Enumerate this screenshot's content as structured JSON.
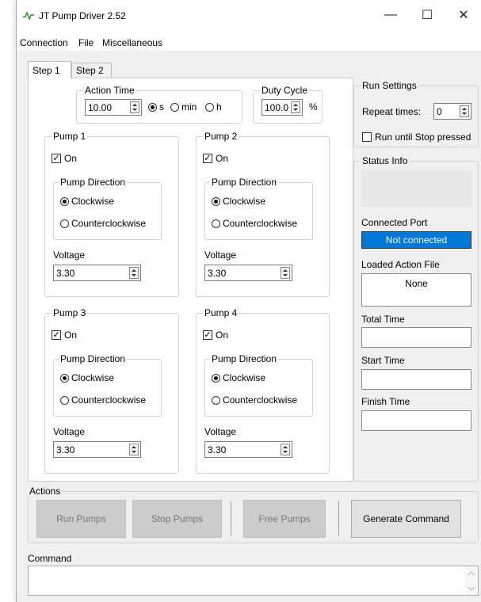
{
  "window": {
    "title": "JT Pump Driver 2.52",
    "minimize": "—",
    "maximize": "☐",
    "close": "✕",
    "accent": "#2a9d2a"
  },
  "menu": {
    "items": [
      "Connection",
      "File",
      "Miscellaneous"
    ]
  },
  "tabs": [
    "Step 1",
    "Step 2"
  ],
  "action_time": {
    "label": "Action Time",
    "value": "10.00",
    "units": [
      "s",
      "min",
      "h"
    ],
    "selected": "s"
  },
  "duty_cycle": {
    "label": "Duty Cycle",
    "value": "100.0",
    "unit": "%"
  },
  "pumps": [
    {
      "title": "Pump 1",
      "on_label": "On",
      "on": true,
      "direction_label": "Pump Direction",
      "cw": "Clockwise",
      "ccw": "Counterclockwise",
      "direction": "cw",
      "voltage_label": "Voltage",
      "voltage": "3.30"
    },
    {
      "title": "Pump 2",
      "on_label": "On",
      "on": true,
      "direction_label": "Pump Direction",
      "cw": "Clockwise",
      "ccw": "Counterclockwise",
      "direction": "cw",
      "voltage_label": "Voltage",
      "voltage": "3.30"
    },
    {
      "title": "Pump 3",
      "on_label": "On",
      "on": true,
      "direction_label": "Pump Direction",
      "cw": "Clockwise",
      "ccw": "Counterclockwise",
      "direction": "cw",
      "voltage_label": "Voltage",
      "voltage": "3.30"
    },
    {
      "title": "Pump 4",
      "on_label": "On",
      "on": true,
      "direction_label": "Pump Direction",
      "cw": "Clockwise",
      "ccw": "Counterclockwise",
      "direction": "cw",
      "voltage_label": "Voltage",
      "voltage": "3.30"
    }
  ],
  "run_settings": {
    "label": "Run Settings",
    "repeat_label": "Repeat times:",
    "repeat_value": "0",
    "run_until_label": "Run until Stop pressed",
    "run_until_checked": false
  },
  "status": {
    "label": "Status Info",
    "connected_port_label": "Connected Port",
    "connected_port_value": "Not connected",
    "connected_port_color": "#0078d7",
    "loaded_file_label": "Loaded Action File",
    "loaded_file_value": "None",
    "total_time_label": "Total Time",
    "start_time_label": "Start Time",
    "finish_time_label": "Finish Time"
  },
  "actions": {
    "label": "Actions",
    "run": "Run Pumps",
    "stop": "Stop Pumps",
    "free": "Free Pumps",
    "generate": "Generate Command"
  },
  "command": {
    "label": "Command",
    "value": ""
  }
}
